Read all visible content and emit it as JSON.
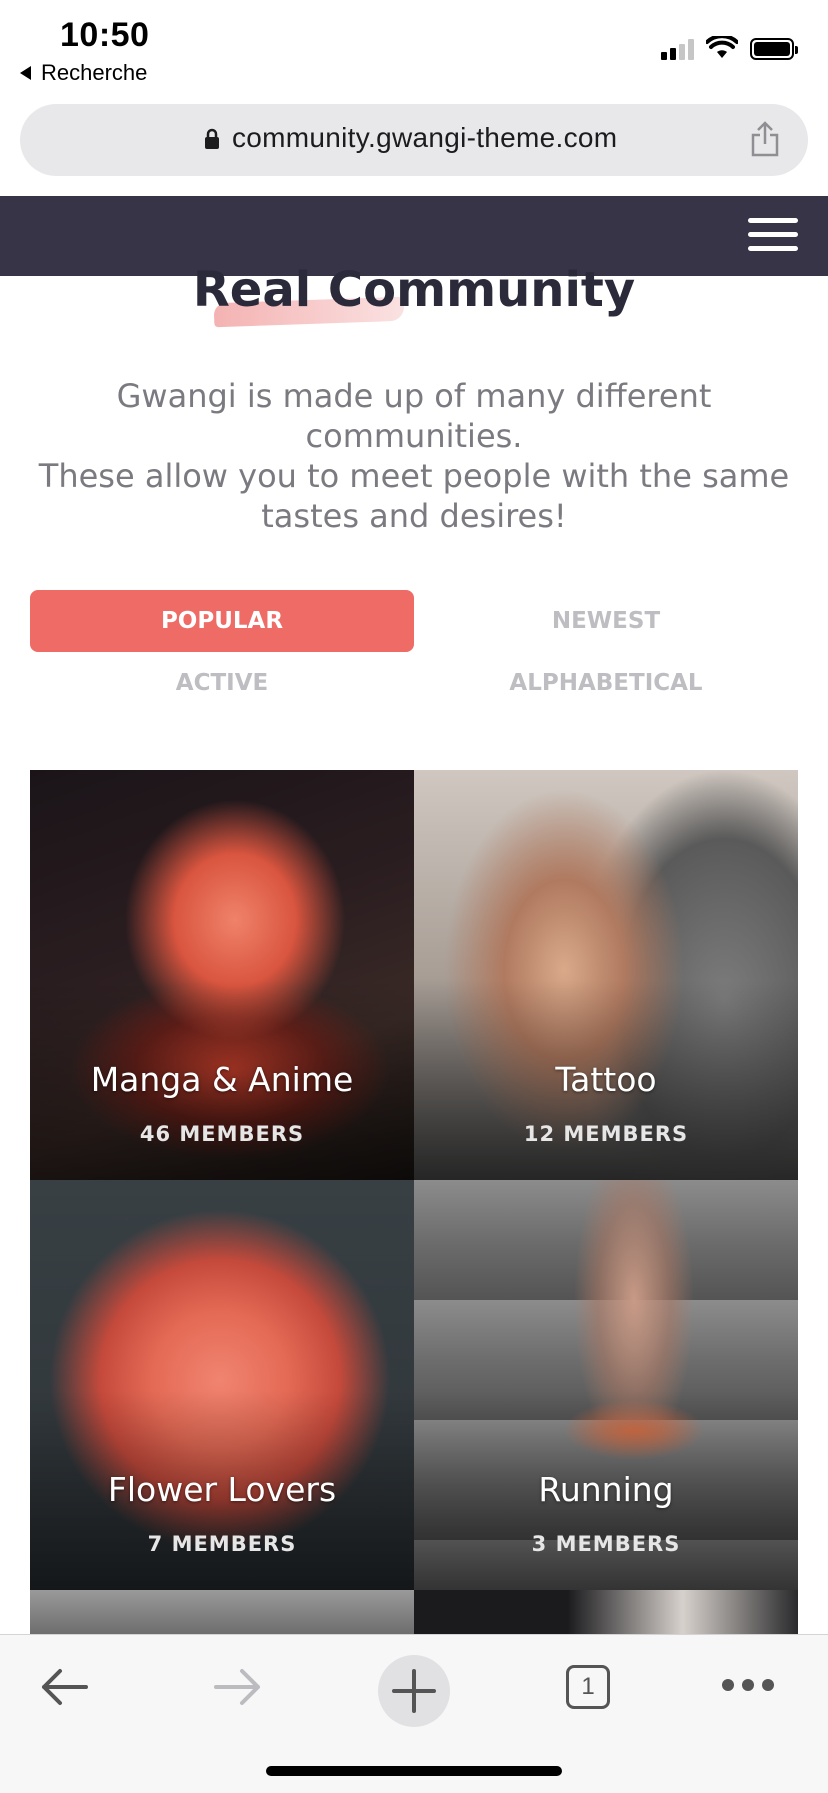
{
  "status_bar": {
    "time": "10:50",
    "back_app": "Recherche",
    "icons": [
      "cellular-signal-icon",
      "wifi-icon",
      "battery-icon"
    ]
  },
  "browser": {
    "url": "community.gwangi-theme.com",
    "icons": [
      "lock-icon",
      "share-icon"
    ]
  },
  "header": {
    "menu_icon": "hamburger-menu-icon"
  },
  "hero": {
    "title": "Real Community",
    "description_line1": "Gwangi is made up of many different communities.",
    "description_line2": "These allow you to meet people with the same tastes and desires!"
  },
  "filters": {
    "tabs": [
      {
        "label": "POPULAR",
        "active": true
      },
      {
        "label": "NEWEST",
        "active": false
      },
      {
        "label": "ACTIVE",
        "active": false
      },
      {
        "label": "ALPHABETICAL",
        "active": false
      }
    ],
    "active_color": "#ee6b66"
  },
  "groups": [
    {
      "name": "Manga & Anime",
      "members": "46 MEMBERS"
    },
    {
      "name": "Tattoo",
      "members": "12 MEMBERS"
    },
    {
      "name": "Flower Lovers",
      "members": "7 MEMBERS"
    },
    {
      "name": "Running",
      "members": "3 MEMBERS"
    }
  ],
  "toolbar": {
    "tab_count": "1",
    "icons": [
      "back-arrow-icon",
      "forward-arrow-icon",
      "new-tab-plus-icon",
      "tabs-icon",
      "more-icon"
    ]
  },
  "colors": {
    "nav_bg": "#363446",
    "heading": "#2b2a3a",
    "body_text": "#7a7a80",
    "inactive_tab": "#bdbdc2"
  }
}
